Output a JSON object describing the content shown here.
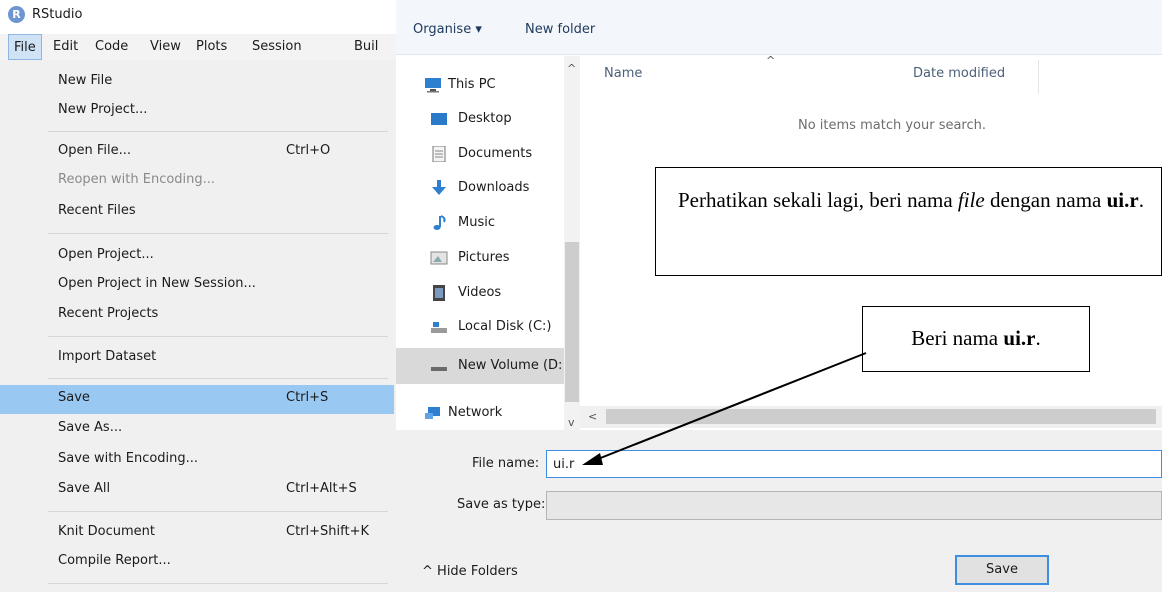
{
  "rstudio": {
    "title": "RStudio",
    "logo_letter": "R",
    "menubar": [
      "File",
      "Edit",
      "Code",
      "View",
      "Plots",
      "Session",
      "Buil"
    ],
    "file_menu": {
      "new_file": "New File",
      "new_project": "New Project...",
      "open_file": "Open File...",
      "open_file_sc": "Ctrl+O",
      "reopen_encoding": "Reopen with Encoding...",
      "recent_files": "Recent Files",
      "open_project": "Open Project...",
      "open_project_new_session": "Open Project in New Session...",
      "recent_projects": "Recent Projects",
      "import_dataset": "Import Dataset",
      "save": "Save",
      "save_sc": "Ctrl+S",
      "save_as": "Save As...",
      "save_with_encoding": "Save with Encoding...",
      "save_all": "Save All",
      "save_all_sc": "Ctrl+Alt+S",
      "knit_document": "Knit Document",
      "knit_document_sc": "Ctrl+Shift+K",
      "compile_report": "Compile Report..."
    }
  },
  "dialog": {
    "toolbar": {
      "organise": "Organise ▾",
      "new_folder": "New folder"
    },
    "nav": {
      "this_pc": "This PC",
      "desktop": "Desktop",
      "documents": "Documents",
      "downloads": "Downloads",
      "music": "Music",
      "pictures": "Pictures",
      "videos": "Videos",
      "local_disk": "Local Disk (C:)",
      "new_volume": "New Volume (D:",
      "network": "Network"
    },
    "columns": {
      "name": "Name",
      "date_modified": "Date modified"
    },
    "empty_message": "No items match your search.",
    "file_name_label": "File name:",
    "file_name_value": "ui.r",
    "save_as_type_label": "Save as type:",
    "hide_folders": "Hide Folders",
    "save_button": "Save"
  },
  "callouts": {
    "main_part1": "Perhatikan sekali lagi, beri nama ",
    "main_italic": "file",
    "main_part2": " dengan nama ",
    "main_bold": "ui.r",
    "main_part3": ".",
    "small_part1": "Beri nama ",
    "small_bold": "ui.r",
    "small_part2": "."
  },
  "colors": {
    "menu_highlight": "#99c9f2",
    "input_focus": "#3c8ee0",
    "rstudio_logo": "#6d95d0"
  }
}
